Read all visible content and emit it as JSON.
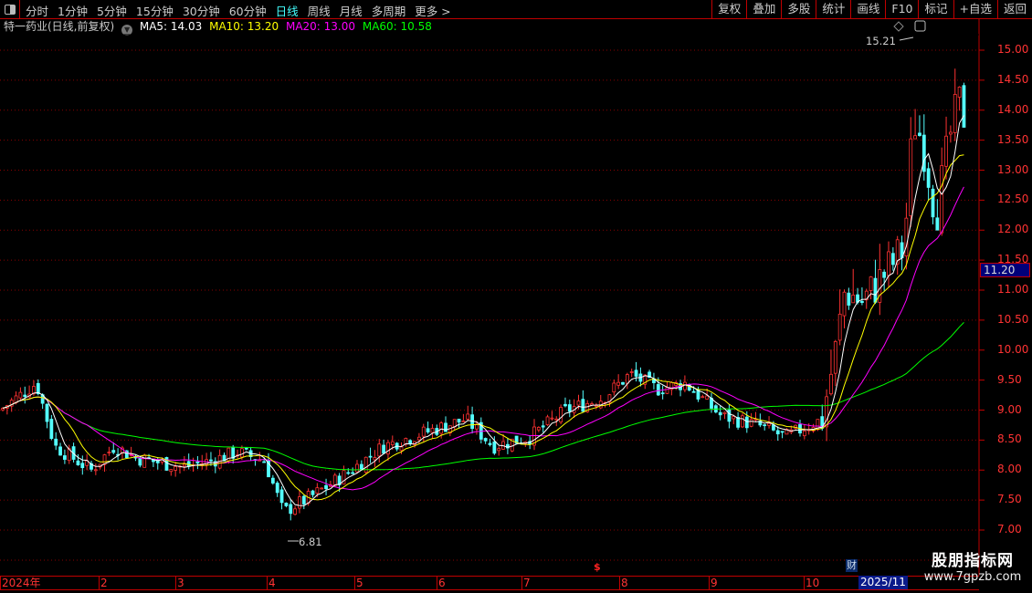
{
  "toolbar": {
    "periods": [
      "分时",
      "1分钟",
      "5分钟",
      "15分钟",
      "30分钟",
      "60分钟",
      "日线",
      "周线",
      "月线",
      "多周期",
      "更多 >"
    ],
    "active_period": "日线",
    "tools": [
      "复权",
      "叠加",
      "多股",
      "统计",
      "画线",
      "F10",
      "标记",
      "+自选",
      "返回"
    ]
  },
  "info": {
    "stock": "特一药业(日线,前复权)",
    "ma5": "MA5: 14.03",
    "ma10": "MA10: 13.20",
    "ma20": "MA20: 13.00",
    "ma60": "MA60: 10.58",
    "colors": {
      "ma5": "#ffffff",
      "ma10": "#ffff00",
      "ma20": "#ff00ff",
      "ma60": "#00ff00",
      "up": "#ff3232",
      "down": "#54ffff"
    }
  },
  "price_axis": [
    "15.00",
    "14.50",
    "14.00",
    "13.50",
    "13.00",
    "12.50",
    "12.00",
    "11.50",
    "11.00",
    "10.50",
    "10.00",
    "9.50",
    "9.00",
    "8.50",
    "8.00",
    "7.50",
    "7.00"
  ],
  "current_price": "11.20",
  "annotations": {
    "high": "15.21",
    "low": "6.81",
    "signal": "$",
    "event": "财"
  },
  "time_axis": [
    "2024年",
    "2",
    "3",
    "4",
    "5",
    "6",
    "7",
    "8",
    "9",
    "10"
  ],
  "time_axis_end": "2025/11",
  "watermark": {
    "title": "股朋指标网",
    "url": "www.7gpzb.com"
  }
}
